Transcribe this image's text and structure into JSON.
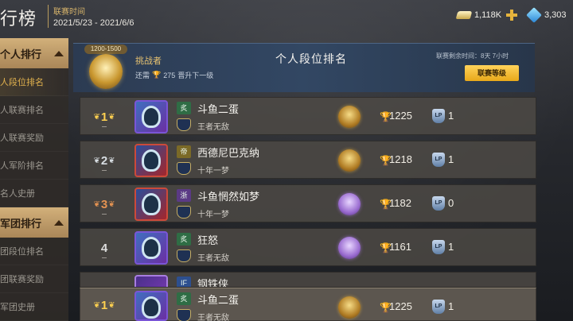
{
  "header": {
    "page_title": "行榜",
    "season_label": "联赛时间",
    "season_dates": "2021/5/23 - 2021/6/6",
    "gold_amount": "1,118K",
    "gem_amount": "3,303"
  },
  "sidebar": {
    "sections": [
      {
        "title": "个人排行",
        "items": [
          "人段位排名",
          "人联赛排名",
          "人联赛奖励",
          "人军阶排名",
          "名人史册"
        ],
        "active_index": 0
      },
      {
        "title": "军团排行",
        "items": [
          "团段位排名",
          "团联赛奖励",
          "军团史册"
        ]
      }
    ]
  },
  "banner": {
    "tier_range": "1200-1500",
    "tier_name": "挑战者",
    "promote_prefix": "还需",
    "promote_points": "275",
    "promote_suffix": "晋升下一级",
    "title": "个人段位排名",
    "season_remaining": "联赛剩余时间：8天 7小时",
    "league_level_button": "联赛等级"
  },
  "rows": [
    {
      "rank": "1",
      "medal": "gold",
      "faction": "炙",
      "faction_color": "green",
      "name": "斗鱼二蛋",
      "guild": "王者无敌",
      "tier": "gold",
      "score": "1225",
      "wins": "1"
    },
    {
      "rank": "2",
      "medal": "silver",
      "faction": "帝",
      "faction_color": "yellow",
      "name": "西德尼巴克纳",
      "guild": "十年一梦",
      "tier": "gold",
      "score": "1218",
      "wins": "1"
    },
    {
      "rank": "3",
      "medal": "bronze",
      "faction": "浙",
      "faction_color": "purple",
      "name": "斗鱼惘然如梦",
      "guild": "十年一梦",
      "tier": "purple",
      "score": "1182",
      "wins": "0"
    },
    {
      "rank": "4",
      "medal": "none",
      "faction": "炙",
      "faction_color": "green",
      "name": "狂怒",
      "guild": "王者无敌",
      "tier": "purple",
      "score": "1161",
      "wins": "1"
    },
    {
      "rank": "",
      "medal": "none",
      "faction": "IF",
      "faction_color": "blue",
      "name": "钢铁侠",
      "guild": "",
      "tier": "purple",
      "score": "",
      "wins": ""
    }
  ],
  "pinned_row": {
    "rank": "1",
    "medal": "gold",
    "faction": "炙",
    "faction_color": "green",
    "name": "斗鱼二蛋",
    "guild": "王者无敌",
    "tier": "gold",
    "score": "1225",
    "wins": "1"
  },
  "colors": {
    "accent_gold": "#e2b24e",
    "button_yellow": "#ffd25a",
    "rank_gold": "#ffd150",
    "rank_bronze": "#e59352"
  }
}
